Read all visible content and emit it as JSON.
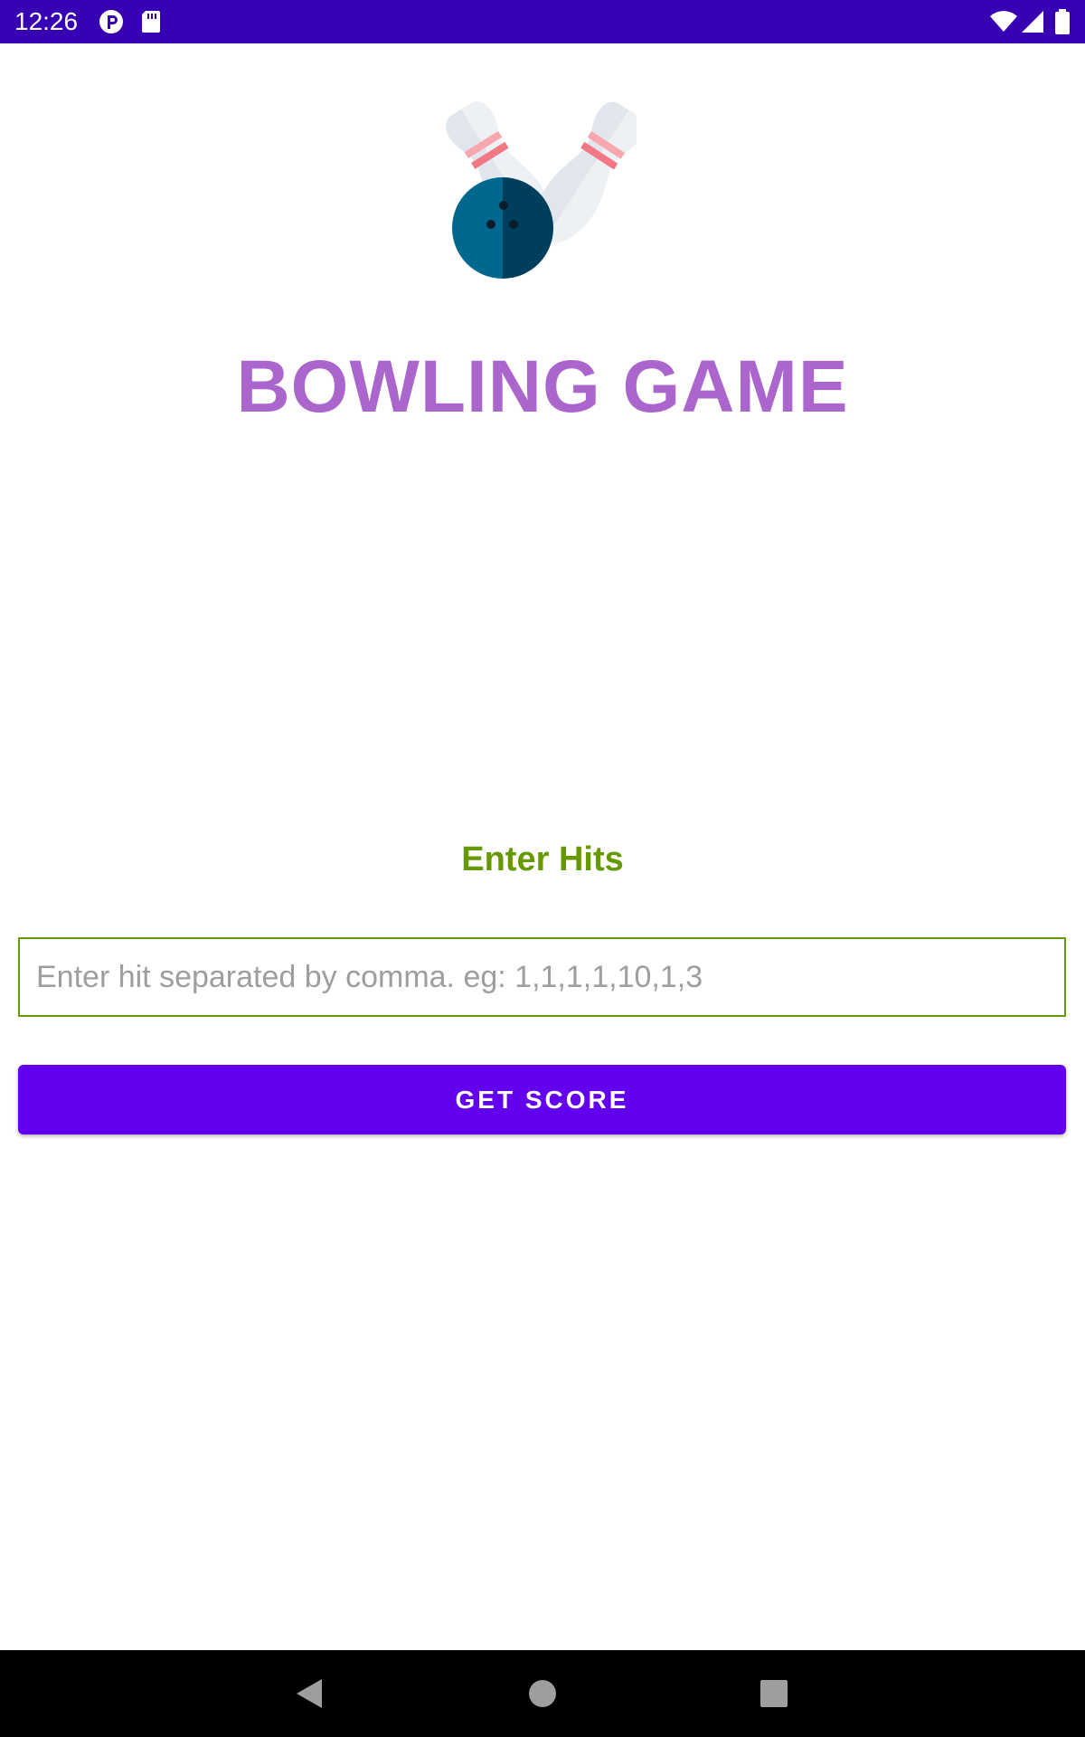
{
  "status_bar": {
    "time": "12:26",
    "background_color": "#3700b3",
    "left_icons": [
      "p-notification-icon",
      "sd-card-icon"
    ],
    "right_icons": [
      "wifi-icon",
      "signal-icon",
      "battery-icon"
    ]
  },
  "app": {
    "logo_icon": "bowling-ball-and-pins-icon",
    "title": "BOWLING GAME",
    "title_color": "#aa66cc"
  },
  "form": {
    "label": "Enter Hits",
    "label_color": "#669900",
    "input_value": "",
    "input_placeholder": "Enter hit separated by comma. eg: 1,1,1,1,10,1,3",
    "button_label": "GET SCORE",
    "button_color": "#6200ee"
  },
  "nav_bar": {
    "buttons": [
      "back-icon",
      "home-icon",
      "recents-icon"
    ]
  }
}
